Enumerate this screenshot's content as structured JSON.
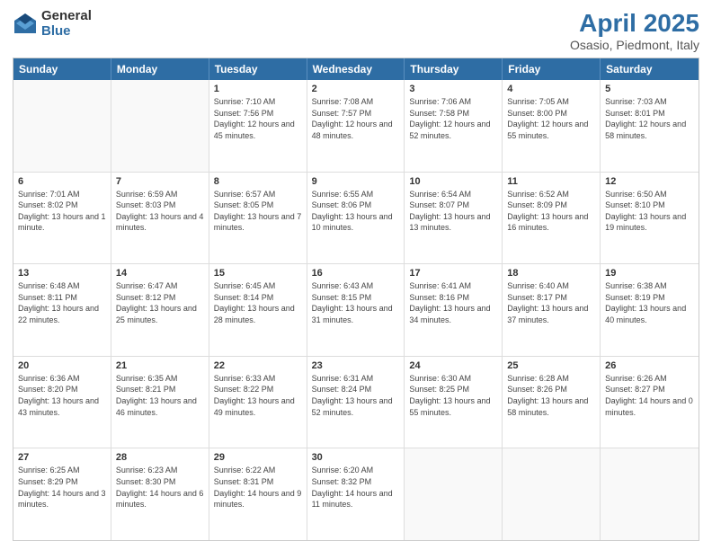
{
  "logo": {
    "general": "General",
    "blue": "Blue"
  },
  "title": {
    "month": "April 2025",
    "location": "Osasio, Piedmont, Italy"
  },
  "header_days": [
    "Sunday",
    "Monday",
    "Tuesday",
    "Wednesday",
    "Thursday",
    "Friday",
    "Saturday"
  ],
  "weeks": [
    [
      {
        "day": "",
        "sunrise": "",
        "sunset": "",
        "daylight": ""
      },
      {
        "day": "",
        "sunrise": "",
        "sunset": "",
        "daylight": ""
      },
      {
        "day": "1",
        "sunrise": "Sunrise: 7:10 AM",
        "sunset": "Sunset: 7:56 PM",
        "daylight": "Daylight: 12 hours and 45 minutes."
      },
      {
        "day": "2",
        "sunrise": "Sunrise: 7:08 AM",
        "sunset": "Sunset: 7:57 PM",
        "daylight": "Daylight: 12 hours and 48 minutes."
      },
      {
        "day": "3",
        "sunrise": "Sunrise: 7:06 AM",
        "sunset": "Sunset: 7:58 PM",
        "daylight": "Daylight: 12 hours and 52 minutes."
      },
      {
        "day": "4",
        "sunrise": "Sunrise: 7:05 AM",
        "sunset": "Sunset: 8:00 PM",
        "daylight": "Daylight: 12 hours and 55 minutes."
      },
      {
        "day": "5",
        "sunrise": "Sunrise: 7:03 AM",
        "sunset": "Sunset: 8:01 PM",
        "daylight": "Daylight: 12 hours and 58 minutes."
      }
    ],
    [
      {
        "day": "6",
        "sunrise": "Sunrise: 7:01 AM",
        "sunset": "Sunset: 8:02 PM",
        "daylight": "Daylight: 13 hours and 1 minute."
      },
      {
        "day": "7",
        "sunrise": "Sunrise: 6:59 AM",
        "sunset": "Sunset: 8:03 PM",
        "daylight": "Daylight: 13 hours and 4 minutes."
      },
      {
        "day": "8",
        "sunrise": "Sunrise: 6:57 AM",
        "sunset": "Sunset: 8:05 PM",
        "daylight": "Daylight: 13 hours and 7 minutes."
      },
      {
        "day": "9",
        "sunrise": "Sunrise: 6:55 AM",
        "sunset": "Sunset: 8:06 PM",
        "daylight": "Daylight: 13 hours and 10 minutes."
      },
      {
        "day": "10",
        "sunrise": "Sunrise: 6:54 AM",
        "sunset": "Sunset: 8:07 PM",
        "daylight": "Daylight: 13 hours and 13 minutes."
      },
      {
        "day": "11",
        "sunrise": "Sunrise: 6:52 AM",
        "sunset": "Sunset: 8:09 PM",
        "daylight": "Daylight: 13 hours and 16 minutes."
      },
      {
        "day": "12",
        "sunrise": "Sunrise: 6:50 AM",
        "sunset": "Sunset: 8:10 PM",
        "daylight": "Daylight: 13 hours and 19 minutes."
      }
    ],
    [
      {
        "day": "13",
        "sunrise": "Sunrise: 6:48 AM",
        "sunset": "Sunset: 8:11 PM",
        "daylight": "Daylight: 13 hours and 22 minutes."
      },
      {
        "day": "14",
        "sunrise": "Sunrise: 6:47 AM",
        "sunset": "Sunset: 8:12 PM",
        "daylight": "Daylight: 13 hours and 25 minutes."
      },
      {
        "day": "15",
        "sunrise": "Sunrise: 6:45 AM",
        "sunset": "Sunset: 8:14 PM",
        "daylight": "Daylight: 13 hours and 28 minutes."
      },
      {
        "day": "16",
        "sunrise": "Sunrise: 6:43 AM",
        "sunset": "Sunset: 8:15 PM",
        "daylight": "Daylight: 13 hours and 31 minutes."
      },
      {
        "day": "17",
        "sunrise": "Sunrise: 6:41 AM",
        "sunset": "Sunset: 8:16 PM",
        "daylight": "Daylight: 13 hours and 34 minutes."
      },
      {
        "day": "18",
        "sunrise": "Sunrise: 6:40 AM",
        "sunset": "Sunset: 8:17 PM",
        "daylight": "Daylight: 13 hours and 37 minutes."
      },
      {
        "day": "19",
        "sunrise": "Sunrise: 6:38 AM",
        "sunset": "Sunset: 8:19 PM",
        "daylight": "Daylight: 13 hours and 40 minutes."
      }
    ],
    [
      {
        "day": "20",
        "sunrise": "Sunrise: 6:36 AM",
        "sunset": "Sunset: 8:20 PM",
        "daylight": "Daylight: 13 hours and 43 minutes."
      },
      {
        "day": "21",
        "sunrise": "Sunrise: 6:35 AM",
        "sunset": "Sunset: 8:21 PM",
        "daylight": "Daylight: 13 hours and 46 minutes."
      },
      {
        "day": "22",
        "sunrise": "Sunrise: 6:33 AM",
        "sunset": "Sunset: 8:22 PM",
        "daylight": "Daylight: 13 hours and 49 minutes."
      },
      {
        "day": "23",
        "sunrise": "Sunrise: 6:31 AM",
        "sunset": "Sunset: 8:24 PM",
        "daylight": "Daylight: 13 hours and 52 minutes."
      },
      {
        "day": "24",
        "sunrise": "Sunrise: 6:30 AM",
        "sunset": "Sunset: 8:25 PM",
        "daylight": "Daylight: 13 hours and 55 minutes."
      },
      {
        "day": "25",
        "sunrise": "Sunrise: 6:28 AM",
        "sunset": "Sunset: 8:26 PM",
        "daylight": "Daylight: 13 hours and 58 minutes."
      },
      {
        "day": "26",
        "sunrise": "Sunrise: 6:26 AM",
        "sunset": "Sunset: 8:27 PM",
        "daylight": "Daylight: 14 hours and 0 minutes."
      }
    ],
    [
      {
        "day": "27",
        "sunrise": "Sunrise: 6:25 AM",
        "sunset": "Sunset: 8:29 PM",
        "daylight": "Daylight: 14 hours and 3 minutes."
      },
      {
        "day": "28",
        "sunrise": "Sunrise: 6:23 AM",
        "sunset": "Sunset: 8:30 PM",
        "daylight": "Daylight: 14 hours and 6 minutes."
      },
      {
        "day": "29",
        "sunrise": "Sunrise: 6:22 AM",
        "sunset": "Sunset: 8:31 PM",
        "daylight": "Daylight: 14 hours and 9 minutes."
      },
      {
        "day": "30",
        "sunrise": "Sunrise: 6:20 AM",
        "sunset": "Sunset: 8:32 PM",
        "daylight": "Daylight: 14 hours and 11 minutes."
      },
      {
        "day": "",
        "sunrise": "",
        "sunset": "",
        "daylight": ""
      },
      {
        "day": "",
        "sunrise": "",
        "sunset": "",
        "daylight": ""
      },
      {
        "day": "",
        "sunrise": "",
        "sunset": "",
        "daylight": ""
      }
    ]
  ]
}
